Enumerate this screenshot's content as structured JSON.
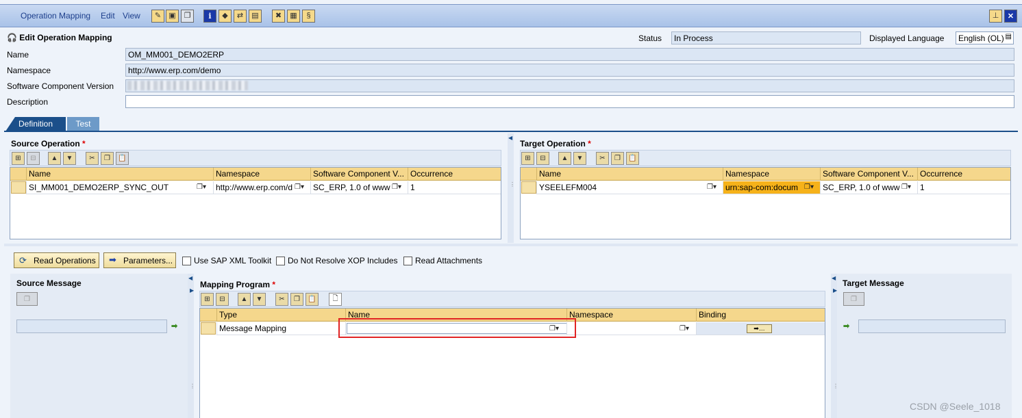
{
  "menu": {
    "operation_mapping": "Operation Mapping",
    "edit": "Edit",
    "view": "View"
  },
  "header": {
    "title": "Edit Operation Mapping",
    "status_label": "Status",
    "status_value": "In Process",
    "language_label": "Displayed Language",
    "language_value": "English (OL)",
    "name_label": "Name",
    "name_value": "OM_MM001_DEMO2ERP",
    "namespace_label": "Namespace",
    "namespace_value": "http://www.erp.com/demo",
    "swcv_label": "Software Component Version",
    "description_label": "Description",
    "description_value": ""
  },
  "tabs": [
    "Definition",
    "Test"
  ],
  "source_operation": {
    "title": "Source Operation",
    "required": "*",
    "columns": [
      "Name",
      "Namespace",
      "Software Component V...",
      "Occurrence"
    ],
    "row": [
      "SI_MM001_DEMO2ERP_SYNC_OUT",
      "http://www.erp.com/d",
      "SC_ERP, 1.0 of www",
      "1"
    ]
  },
  "target_operation": {
    "title": "Target Operation",
    "required": "*",
    "columns": [
      "Name",
      "Namespace",
      "Software Component V...",
      "Occurrence"
    ],
    "row": [
      "YSEELEFM004",
      "urn:sap-com:docum",
      "SC_ERP, 1.0 of www",
      "1"
    ]
  },
  "actions": {
    "read_operations": "Read Operations",
    "parameters": "Parameters...",
    "use_sap_xml_toolkit": "Use SAP XML Toolkit",
    "do_not_resolve_xop": "Do Not Resolve XOP Includes",
    "read_attachments": "Read Attachments"
  },
  "source_message": {
    "title": "Source Message"
  },
  "target_message": {
    "title": "Target Message"
  },
  "mapping_program": {
    "title": "Mapping Program",
    "required": "*",
    "columns": [
      "Type",
      "Name",
      "Namespace",
      "Binding"
    ],
    "row": [
      "Message Mapping",
      "",
      "",
      ""
    ]
  },
  "colors": {
    "highlight_box": "#e02424",
    "namespace_highlight": "#f6b21a",
    "grid_header": "#f5d78c"
  },
  "watermark": "CSDN @Seele_1018"
}
